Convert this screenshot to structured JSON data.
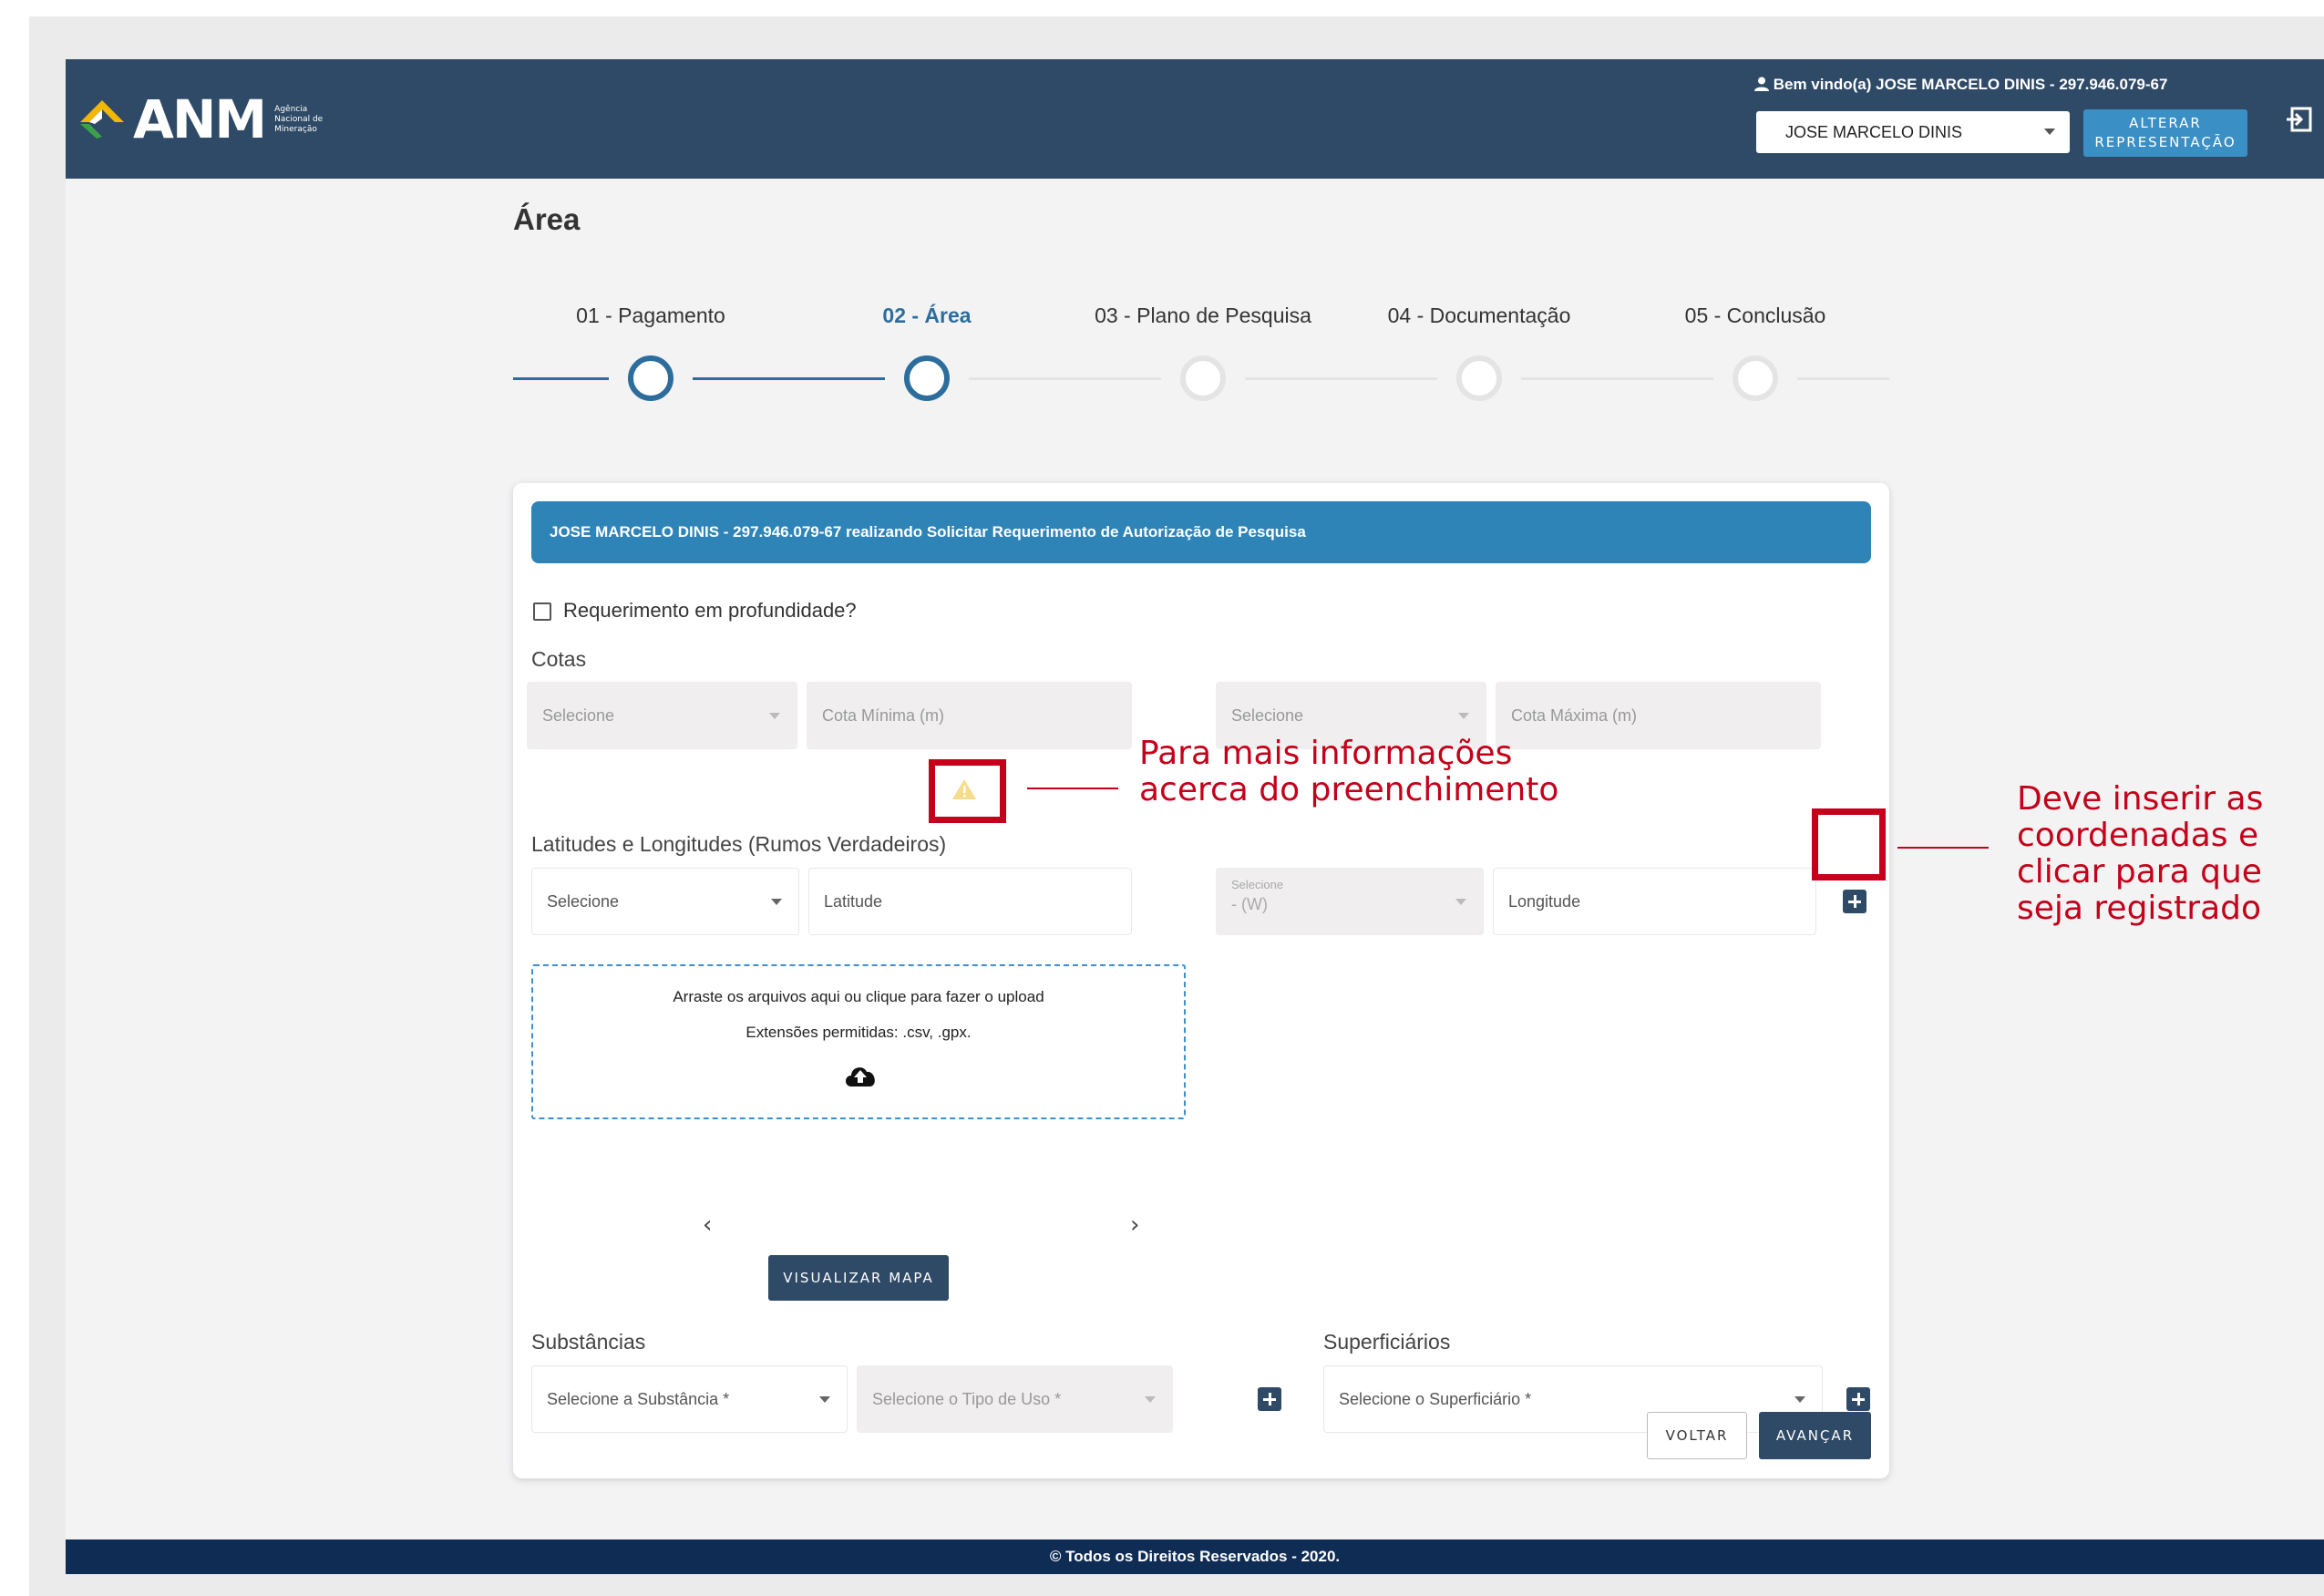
{
  "header": {
    "logo_text": "ANM",
    "logo_sub": [
      "Agência",
      "Nacional de",
      "Mineração"
    ],
    "welcome": "Bem vindo(a) JOSE MARCELO DINIS - 297.946.079-67",
    "representation_value": "JOSE MARCELO DINIS",
    "alter_button": [
      "ALTERAR",
      "REPRESENTAÇÃO"
    ]
  },
  "page": {
    "title": "Área"
  },
  "stepper": [
    {
      "label": "01 - Pagamento",
      "status": "done"
    },
    {
      "label": "02 - Área",
      "status": "active"
    },
    {
      "label": "03 - Plano de Pesquisa",
      "status": "todo"
    },
    {
      "label": "04 - Documentação",
      "status": "todo"
    },
    {
      "label": "05 - Conclusão",
      "status": "todo"
    }
  ],
  "form": {
    "banner": "JOSE MARCELO DINIS - 297.946.079-67 realizando Solicitar Requerimento de Autorização de Pesquisa",
    "depth_checkbox_label": "Requerimento em profundidade?",
    "cotas_label": "Cotas",
    "cota_min_select": "Selecione",
    "cota_min_placeholder": "Cota Mínima (m)",
    "cota_max_select": "Selecione",
    "cota_max_placeholder": "Cota Máxima (m)",
    "latlong_label": "Latitudes e Longitudes (Rumos Verdadeiros)",
    "lat_select": "Selecione",
    "lat_placeholder": "Latitude",
    "long_select_small": "Selecione",
    "long_select_value": "- (W)",
    "long_placeholder": "Longitude",
    "dropzone_line1": "Arraste os arquivos aqui ou clique para fazer o upload",
    "dropzone_line2": "Extensões permitidas: .csv, .gpx.",
    "prev_arrow": "‹",
    "next_arrow": "›",
    "view_map_button": "VISUALIZAR MAPA",
    "substancias_label": "Substâncias",
    "substancia_select": "Selecione a Substância *",
    "tipo_uso_select": "Selecione o Tipo de Uso *",
    "superficiarios_label": "Superficiários",
    "superficiario_select": "Selecione o Superficiário *",
    "back_button": "VOLTAR",
    "next_button": "AVANÇAR"
  },
  "footer": {
    "text": "© Todos os Direitos Reservados - 2020."
  },
  "annotations": {
    "info_note": [
      "Para mais informações",
      "acerca do preenchimento"
    ],
    "coords_note": [
      "Deve inserir as",
      "coordenadas e",
      "clicar para que",
      "seja registrado"
    ]
  },
  "colors": {
    "header_bg": "#2f4a66",
    "accent": "#2f84b7",
    "annotation_red": "#c4001a",
    "footer_bg": "#0f2c55"
  }
}
